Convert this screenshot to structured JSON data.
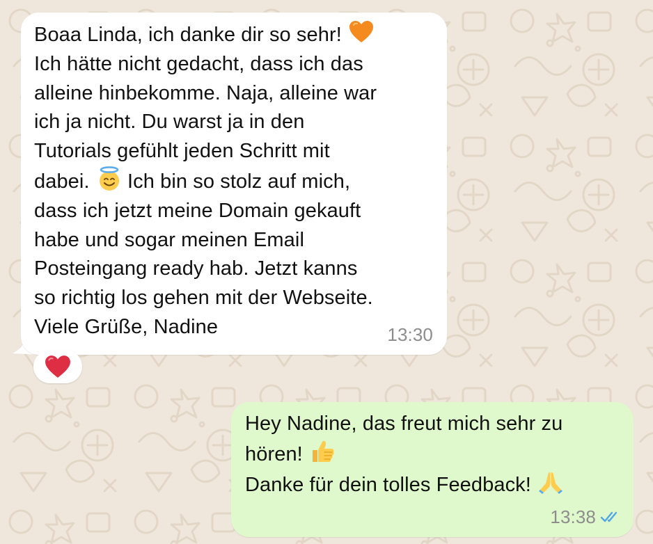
{
  "incoming_message": {
    "lines": [
      "Boaa Linda, ich danke dir so sehr!",
      "Ich hätte nicht gedacht, dass ich das",
      "alleine hinbekomme. Naja, alleine war",
      "ich ja nicht. Du warst ja in den",
      "Tutorials gefühlt jeden Schritt mit",
      "dabei.",
      "Ich bin so stolz auf mich,",
      "dass ich jetzt meine Domain gekauft",
      "habe und sogar meinen Email",
      "Posteingang ready hab. Jetzt kanns",
      "so richtig los gehen mit der Webseite.",
      "Viele Grüße, Nadine"
    ],
    "emojis": [
      "orange-heart-emoji",
      "smiling-face-with-halo-emoji"
    ],
    "time": "13:30",
    "reaction": "red-heart-emoji"
  },
  "outgoing_message": {
    "lines": [
      "Hey Nadine, das freut mich sehr zu",
      "hören!",
      "Danke für dein tolles Feedback!"
    ],
    "emojis": [
      "thumbs-up-emoji",
      "folded-hands-emoji"
    ],
    "time": "13:38",
    "status": "read",
    "status_icon": "double-check-icon"
  },
  "colors": {
    "wallpaper": "#efe7dc",
    "incoming_bubble": "#ffffff",
    "outgoing_bubble": "#dff9cd",
    "timestamp": "#8d8d8d",
    "read_ticks": "#4fa7e8"
  }
}
